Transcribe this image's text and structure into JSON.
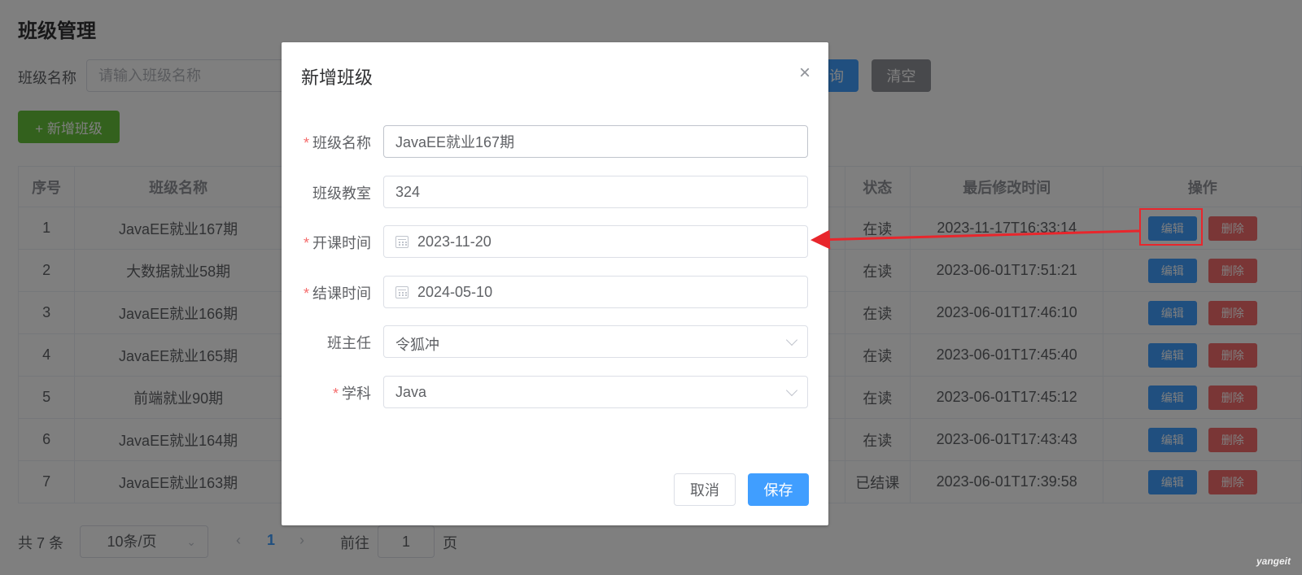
{
  "page": {
    "title": "班级管理",
    "filter": {
      "label": "班级名称",
      "placeholder": "请输入班级名称"
    },
    "query_button": "询",
    "clear_button": "清空",
    "add_button": "+ 新增班级"
  },
  "table": {
    "headers": [
      "序号",
      "班级名称",
      "状态",
      "最后修改时间",
      "操作"
    ],
    "edit_label": "编辑",
    "delete_label": "删除",
    "rows": [
      {
        "no": "1",
        "name": "JavaEE就业167期",
        "status": "在读",
        "modified": "2023-11-17T16:33:14"
      },
      {
        "no": "2",
        "name": "大数据就业58期",
        "status": "在读",
        "modified": "2023-06-01T17:51:21"
      },
      {
        "no": "3",
        "name": "JavaEE就业166期",
        "status": "在读",
        "modified": "2023-06-01T17:46:10"
      },
      {
        "no": "4",
        "name": "JavaEE就业165期",
        "status": "在读",
        "modified": "2023-06-01T17:45:40"
      },
      {
        "no": "5",
        "name": "前端就业90期",
        "status": "在读",
        "modified": "2023-06-01T17:45:12"
      },
      {
        "no": "6",
        "name": "JavaEE就业164期",
        "status": "在读",
        "modified": "2023-06-01T17:43:43"
      },
      {
        "no": "7",
        "name": "JavaEE就业163期",
        "status": "已结课",
        "modified": "2023-06-01T17:39:58"
      }
    ]
  },
  "pagination": {
    "total": "共 7 条",
    "page_size": "10条/页",
    "current_page": "1",
    "goto_label": "前往",
    "goto_value": "1",
    "page_suffix": "页"
  },
  "dialog": {
    "title": "新增班级",
    "fields": {
      "class_name": {
        "label": "班级名称",
        "value": "JavaEE就业167期"
      },
      "classroom": {
        "label": "班级教室",
        "value": "324"
      },
      "start_date": {
        "label": "开课时间",
        "value": "2023-11-20"
      },
      "end_date": {
        "label": "结课时间",
        "value": "2024-05-10"
      },
      "head_teacher": {
        "label": "班主任",
        "value": "令狐冲"
      },
      "subject": {
        "label": "学科",
        "value": "Java"
      }
    },
    "cancel_button": "取消",
    "save_button": "保存"
  },
  "watermark": "yangeit",
  "colors": {
    "primary": "#409eff",
    "success": "#67c23a",
    "danger": "#f56c6c",
    "info": "#909399",
    "annotation": "#e8262c"
  },
  "icons": [
    "close-icon",
    "calendar-icon",
    "chevron-down-icon",
    "chevron-left-icon",
    "chevron-right-icon"
  ]
}
